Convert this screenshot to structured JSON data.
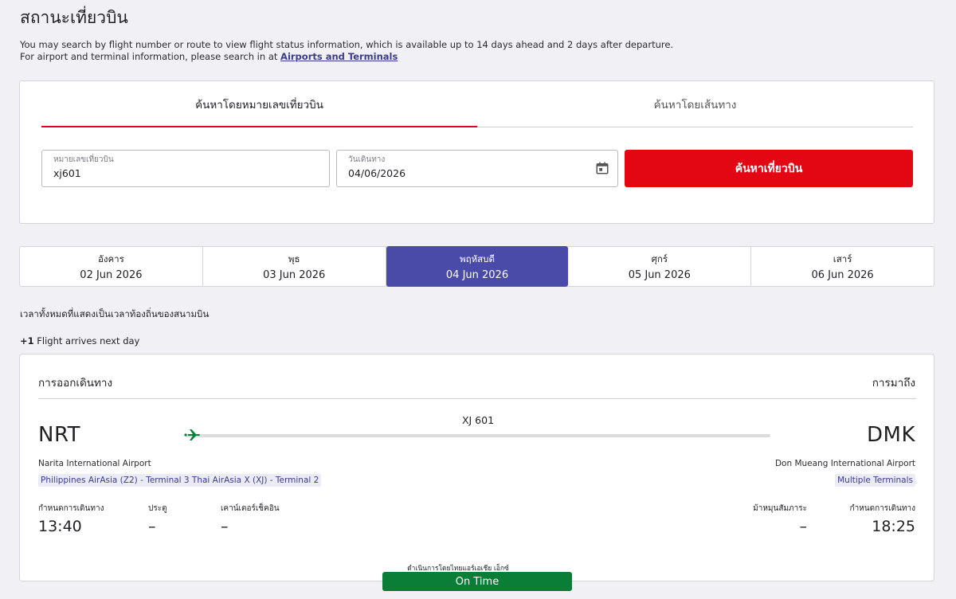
{
  "page": {
    "title": "สถานะเที่ยวบิน",
    "intro_line1": "You may search by flight number or route to view flight status information, which is available up to 14 days ahead and 2 days after departure.",
    "intro_line2_prefix": "For airport and terminal information, please search in at ",
    "intro_link": "Airports and Terminals"
  },
  "search": {
    "tab_flight": "ค้นหาโดยหมายเลขเที่ยวบิน",
    "tab_route": "ค้นหาโดยเส้นทาง",
    "flight_label": "หมายเลขเที่ยวบิน",
    "flight_value": "xj601",
    "date_label": "วันเดินทาง",
    "date_value": "04/06/2026",
    "button": "ค้นหาเที่ยวบิน"
  },
  "days": [
    {
      "name": "อังคาร",
      "date": "02 Jun 2026"
    },
    {
      "name": "พุธ",
      "date": "03 Jun 2026"
    },
    {
      "name": "พฤหัสบดี",
      "date": "04 Jun 2026",
      "active": true
    },
    {
      "name": "ศุกร์",
      "date": "05 Jun 2026"
    },
    {
      "name": "เสาร์",
      "date": "06 Jun 2026"
    }
  ],
  "notes": {
    "local_time": "เวลาทั้งหมดที่แสดงเป็นเวลาท้องถิ่นของสนามบิน",
    "next_day_marker": "+1",
    "next_day_text": " Flight arrives next day"
  },
  "flight": {
    "departure_header": "การออกเดินทาง",
    "arrival_header": "การมาถึง",
    "flight_number": "XJ 601",
    "dep_code": "NRT",
    "arr_code": "DMK",
    "dep_airport": "Narita International Airport",
    "arr_airport": "Don Mueang International Airport",
    "dep_terminal": "Philippines AirAsia (Z2) - Terminal 3 Thai AirAsia X (XJ) - Terminal 2",
    "arr_terminal": "Multiple Terminals",
    "dep_sched_label": "กำหนดการเดินทาง",
    "dep_time": "13:40",
    "gate_label": "ประตู",
    "gate_value": "–",
    "counter_label": "เคาน์เตอร์เช็คอิน",
    "counter_value": "–",
    "belt_label": "ม้าหมุนสัมภาระ",
    "belt_value": "–",
    "arr_sched_label": "กำหนดการเดินทาง",
    "arr_time": "18:25",
    "operated_by": "ดำเนินการโดยไทยแอร์เอเชีย เอ็กซ์",
    "status": "On Time",
    "status_color": "#0a7d36",
    "plane_color": "#0a7d36"
  },
  "colors": {
    "brand_red": "#e30613",
    "active_day": "#4a4aa8",
    "link": "#3c3b8e"
  }
}
